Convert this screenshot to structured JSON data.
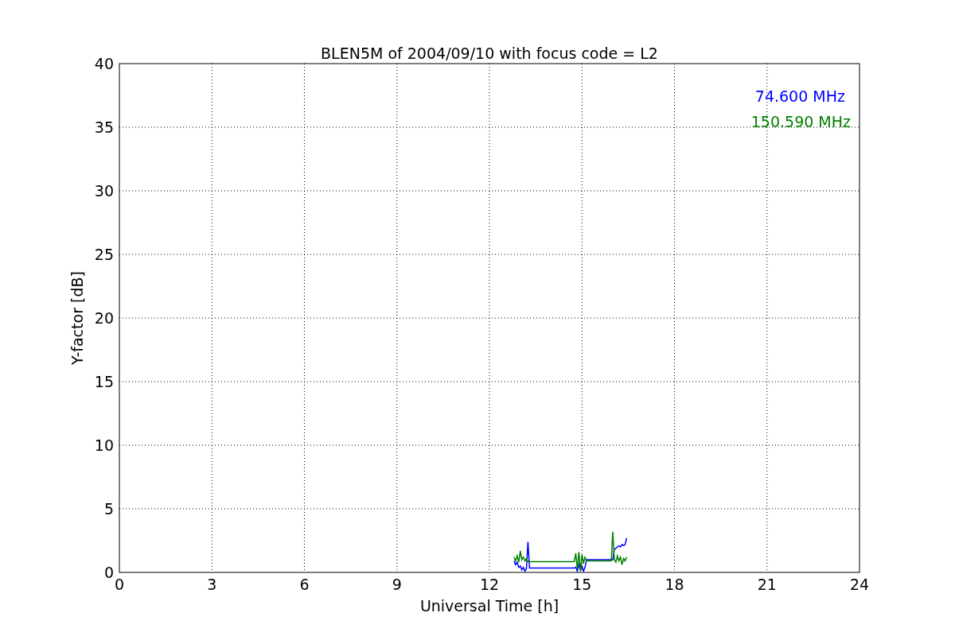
{
  "figure": {
    "chart_data": {
      "type": "line",
      "title": "BLEN5M of 2004/09/10 with focus code = L2",
      "xlabel": "Universal Time [h]",
      "ylabel": "Y-factor [dB]",
      "xlim": [
        0,
        24
      ],
      "ylim": [
        0,
        40
      ],
      "xticks": [
        0,
        3,
        6,
        9,
        12,
        15,
        18,
        21,
        24
      ],
      "yticks": [
        0,
        5,
        10,
        15,
        20,
        25,
        30,
        35,
        40
      ],
      "grid": true,
      "x": [
        12.8,
        12.85,
        12.9,
        12.95,
        13.0,
        13.05,
        13.1,
        13.15,
        13.2,
        13.25,
        13.3,
        14.75,
        14.8,
        14.85,
        14.9,
        14.95,
        15.0,
        15.05,
        15.1,
        15.15,
        15.95,
        16.0,
        16.05,
        16.1,
        16.15,
        16.2,
        16.25,
        16.3,
        16.35,
        16.4,
        16.45
      ],
      "series": [
        {
          "name": "74.600 MHz",
          "color": "#0000ff",
          "values": [
            0.9,
            0.6,
            0.8,
            0.4,
            0.5,
            0.2,
            0.4,
            0.1,
            0.3,
            2.4,
            0.35,
            0.35,
            0.4,
            0.1,
            0.6,
            0.2,
            0.5,
            0.1,
            0.4,
            1.0,
            1.0,
            1.0,
            1.8,
            1.9,
            2.0,
            2.1,
            2.0,
            2.2,
            2.1,
            2.2,
            2.7
          ]
        },
        {
          "name": "150.590 MHz",
          "color": "#008000",
          "values": [
            1.2,
            0.9,
            1.3,
            0.8,
            1.7,
            1.0,
            1.2,
            0.9,
            1.1,
            0.85,
            0.85,
            0.85,
            1.5,
            0.3,
            1.6,
            0.1,
            1.4,
            0.7,
            1.2,
            0.9,
            0.9,
            3.2,
            1.0,
            0.8,
            1.3,
            0.9,
            1.2,
            0.6,
            1.1,
            0.9,
            1.2
          ]
        }
      ]
    }
  }
}
